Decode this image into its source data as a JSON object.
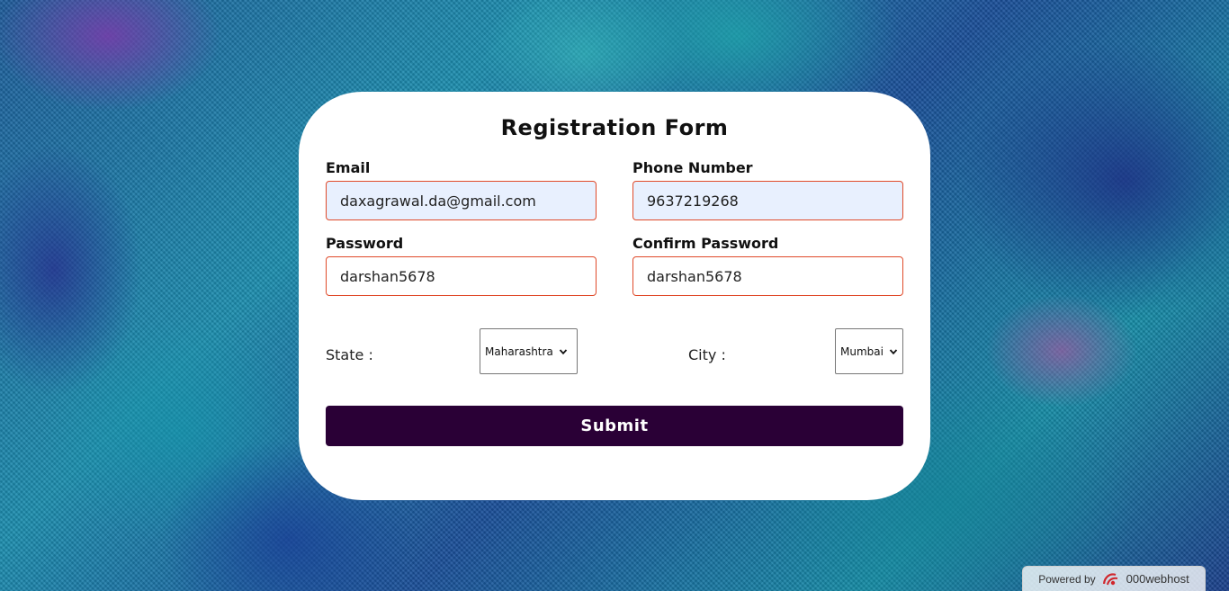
{
  "form": {
    "title": "Registration Form",
    "email": {
      "label": "Email",
      "value": "daxagrawal.da@gmail.com"
    },
    "phone": {
      "label": "Phone Number",
      "value": "9637219268"
    },
    "password": {
      "label": "Password",
      "value": "darshan5678"
    },
    "confirm_password": {
      "label": "Confirm Password",
      "value": "darshan5678"
    },
    "state": {
      "label": "State :",
      "selected": "Maharashtra"
    },
    "city": {
      "label": "City :",
      "selected": "Mumbai"
    },
    "submit_label": "Submit"
  },
  "footer": {
    "powered_by": "Powered by",
    "host_name": "000webhost"
  },
  "colors": {
    "submit_bg": "#2a0036",
    "field_border": "#e04a2a",
    "autofill_bg": "#e8f0fe"
  },
  "icons": {
    "select_arrow": "chevron-down-icon",
    "host_logo": "000webhost-logo-icon"
  }
}
